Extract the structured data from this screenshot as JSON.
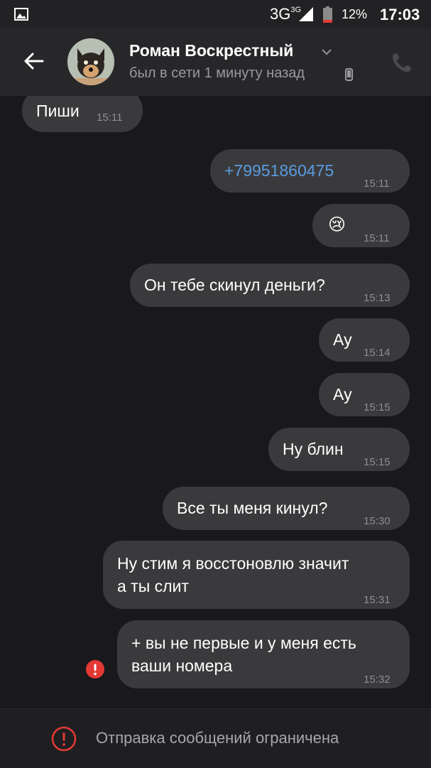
{
  "status_bar": {
    "network": "3G",
    "network_sup": "3G",
    "battery": "12%",
    "time": "17:03"
  },
  "header": {
    "contact_name": "Роман Воскрестный",
    "status": "был в сети 1 минуту назад"
  },
  "messages": [
    {
      "text": "Пиши",
      "time": "15:11",
      "side": "incoming"
    },
    {
      "text": "+79951860475",
      "time": "15:11",
      "side": "outgoing",
      "is_link": true
    },
    {
      "text": "😢",
      "time": "15:11",
      "side": "outgoing"
    },
    {
      "text": "Он тебе скинул деньги?",
      "time": "15:13",
      "side": "outgoing"
    },
    {
      "text": "Ау",
      "time": "15:14",
      "side": "outgoing"
    },
    {
      "text": "Ау",
      "time": "15:15",
      "side": "outgoing"
    },
    {
      "text": "Ну блин",
      "time": "15:15",
      "side": "outgoing"
    },
    {
      "text": "Все ты меня кинул?",
      "time": "15:30",
      "side": "outgoing"
    },
    {
      "text": "Ну стим я восстоновлю значит\nа ты слит",
      "time": "15:31",
      "side": "outgoing"
    },
    {
      "text": "+ вы не первые и у меня есть\nваши номера",
      "time": "15:32",
      "side": "outgoing",
      "failed": true
    }
  ],
  "footer": {
    "restriction_text": "Отправка сообщений ограничена"
  },
  "colors": {
    "background": "#19191b",
    "bubble": "#3a3a3c",
    "link": "#5b9be0",
    "error": "#e53935"
  },
  "icons": [
    "gallery-icon",
    "signal-icon",
    "battery-icon",
    "back-arrow-icon",
    "chevron-down-icon",
    "mobile-phone-icon",
    "phone-call-icon",
    "error-icon",
    "warning-icon"
  ]
}
